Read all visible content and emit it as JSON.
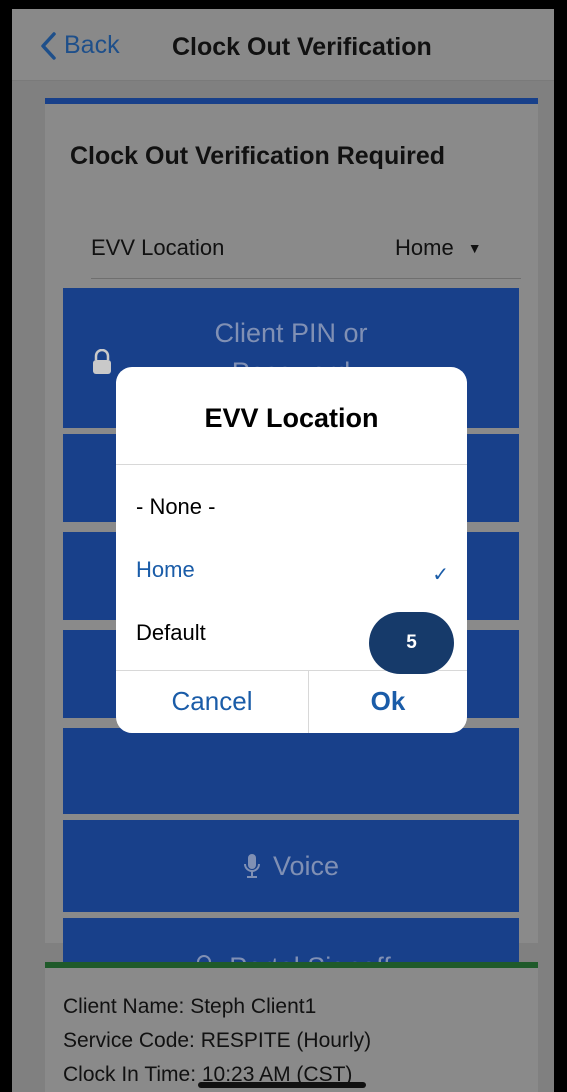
{
  "navbar": {
    "back_label": "Back",
    "title": "Clock Out Verification"
  },
  "card": {
    "title": "Clock Out Verification Required",
    "evv_label": "EVV Location",
    "evv_value": "Home"
  },
  "buttons": {
    "pin_line1": "Client PIN or",
    "pin_line2": "Password",
    "voice_label": "Voice",
    "portal_label": "Portal Signoff"
  },
  "dialog": {
    "title": "EVV Location",
    "options": [
      "- None -",
      "Home",
      "Default"
    ],
    "selected": "Home",
    "cancel_label": "Cancel",
    "ok_label": "Ok"
  },
  "badge": {
    "number": "5"
  },
  "info": {
    "client_name": "Client Name: Steph Client1",
    "service_code": "Service Code: RESPITE (Hourly)",
    "clock_in": "Clock In Time: 10:23 AM (CST)"
  },
  "colors": {
    "primary_blue": "#18408a",
    "link_blue": "#1a5ca8",
    "success_green": "#1f5a2a"
  }
}
